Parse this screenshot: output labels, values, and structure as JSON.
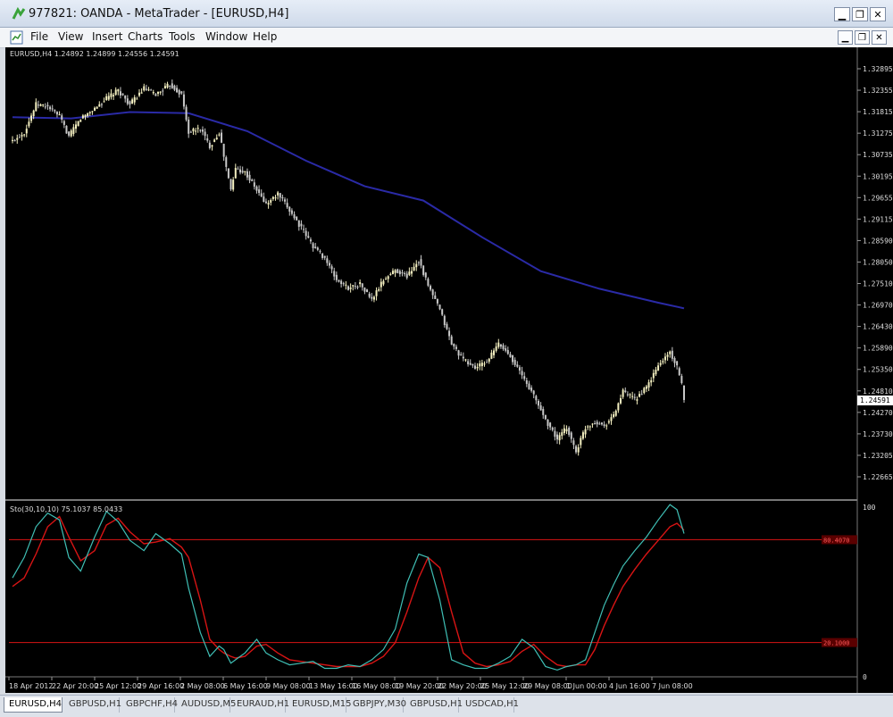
{
  "window": {
    "title": "977821: OANDA - MetaTrader - [EURUSD,H4]",
    "controls": [
      "minimize",
      "restore",
      "close"
    ]
  },
  "menu": {
    "items": [
      "File",
      "View",
      "Insert",
      "Charts",
      "Tools",
      "Window",
      "Help"
    ]
  },
  "chart": {
    "info_line": "EURUSD,H4  1.24892 1.24899 1.24556 1.24591",
    "current_price": "1.24591",
    "price_ticks": [
      "1.32895",
      "1.32355",
      "1.31815",
      "1.31275",
      "1.30735",
      "1.30195",
      "1.29655",
      "1.29115",
      "1.28590",
      "1.28050",
      "1.27510",
      "1.26970",
      "1.26430",
      "1.25890",
      "1.25350",
      "1.24810",
      "1.24270",
      "1.23730",
      "1.23205",
      "1.22665"
    ],
    "time_ticks": [
      "18 Apr 2012",
      "22 Apr 20:00",
      "25 Apr 12:00",
      "29 Apr 16:00",
      "2 May 08:00",
      "6 May 16:00",
      "9 May 08:00",
      "13 May 16:00",
      "16 May 08:00",
      "19 May 20:00",
      "22 May 20:00",
      "25 May 12:00",
      "29 May 08:00",
      "1 Jun 00:00",
      "4 Jun 16:00",
      "7 Jun 08:00"
    ],
    "indicator_info": "Sto(30,10,10) 75.1037 85.0433",
    "indicator_ticks": [
      "100",
      "0"
    ],
    "level_high": "80.4070",
    "level_low": "20.1000",
    "colors": {
      "background": "#000000",
      "candle_up": "#f3efc0",
      "candle_down": "#c8c8c8",
      "ma": "#2a2aa6",
      "stoch_main": "#3fbfb5",
      "stoch_signal": "#d81414",
      "levels": "#d81414"
    }
  },
  "chart_data": {
    "type": "candlestick",
    "symbol": "EURUSD",
    "timeframe": "H4",
    "x_start": "18 Apr 2012",
    "x_end": "7 Jun 08:00",
    "ylim": [
      1.22665,
      1.32895
    ],
    "price_path": [
      [
        0,
        1.3108
      ],
      [
        5,
        1.313
      ],
      [
        10,
        1.32
      ],
      [
        15,
        1.3195
      ],
      [
        20,
        1.317
      ],
      [
        24,
        1.312
      ],
      [
        29,
        1.3165
      ],
      [
        35,
        1.319
      ],
      [
        40,
        1.3215
      ],
      [
        45,
        1.3235
      ],
      [
        50,
        1.32
      ],
      [
        56,
        1.324
      ],
      [
        61,
        1.3225
      ],
      [
        67,
        1.325
      ],
      [
        72,
        1.3225
      ],
      [
        75,
        1.313
      ],
      [
        80,
        1.314
      ],
      [
        84,
        1.3095
      ],
      [
        88,
        1.313
      ],
      [
        90,
        1.307
      ],
      [
        93,
        1.2985
      ],
      [
        95,
        1.304
      ],
      [
        99,
        1.303
      ],
      [
        104,
        1.2985
      ],
      [
        108,
        1.295
      ],
      [
        113,
        1.2975
      ],
      [
        118,
        1.2935
      ],
      [
        123,
        1.289
      ],
      [
        128,
        1.2845
      ],
      [
        133,
        1.2815
      ],
      [
        138,
        1.276
      ],
      [
        143,
        1.274
      ],
      [
        148,
        1.275
      ],
      [
        153,
        1.271
      ],
      [
        158,
        1.276
      ],
      [
        163,
        1.2785
      ],
      [
        168,
        1.277
      ],
      [
        173,
        1.281
      ],
      [
        177,
        1.2745
      ],
      [
        182,
        1.2685
      ],
      [
        187,
        1.26
      ],
      [
        192,
        1.256
      ],
      [
        197,
        1.254
      ],
      [
        202,
        1.2555
      ],
      [
        207,
        1.26
      ],
      [
        212,
        1.257
      ],
      [
        217,
        1.252
      ],
      [
        222,
        1.247
      ],
      [
        227,
        1.241
      ],
      [
        232,
        1.236
      ],
      [
        236,
        1.239
      ],
      [
        240,
        1.233
      ],
      [
        244,
        1.239
      ],
      [
        248,
        1.2405
      ],
      [
        252,
        1.2395
      ],
      [
        256,
        1.242
      ],
      [
        260,
        1.248
      ],
      [
        265,
        1.246
      ],
      [
        270,
        1.249
      ],
      [
        275,
        1.2545
      ],
      [
        280,
        1.258
      ],
      [
        283,
        1.254
      ],
      [
        286,
        1.2475
      ]
    ],
    "ma_values": [
      [
        0,
        1.3168
      ],
      [
        25,
        1.3165
      ],
      [
        50,
        1.3181
      ],
      [
        75,
        1.3178
      ],
      [
        100,
        1.3133
      ],
      [
        125,
        1.3059
      ],
      [
        150,
        1.2995
      ],
      [
        175,
        1.2959
      ],
      [
        200,
        1.2867
      ],
      [
        225,
        1.2782
      ],
      [
        250,
        1.2738
      ],
      [
        275,
        1.2703
      ],
      [
        286,
        1.2689
      ]
    ],
    "stochastic": {
      "ylim": [
        0,
        100
      ],
      "levels": [
        80.407,
        20.1
      ],
      "main_value": 75.1037,
      "signal_value": 85.0433,
      "main": [
        [
          0,
          58
        ],
        [
          5,
          70
        ],
        [
          10,
          88
        ],
        [
          15,
          96
        ],
        [
          20,
          92
        ],
        [
          24,
          70
        ],
        [
          29,
          62
        ],
        [
          35,
          82
        ],
        [
          40,
          97
        ],
        [
          45,
          91
        ],
        [
          50,
          80
        ],
        [
          56,
          74
        ],
        [
          61,
          84
        ],
        [
          67,
          78
        ],
        [
          72,
          72
        ],
        [
          75,
          52
        ],
        [
          80,
          26
        ],
        [
          84,
          12
        ],
        [
          88,
          18
        ],
        [
          90,
          16
        ],
        [
          93,
          8
        ],
        [
          95,
          10
        ],
        [
          99,
          14
        ],
        [
          104,
          22
        ],
        [
          108,
          14
        ],
        [
          113,
          10
        ],
        [
          118,
          7
        ],
        [
          123,
          8
        ],
        [
          128,
          9
        ],
        [
          133,
          5
        ],
        [
          138,
          5
        ],
        [
          143,
          7
        ],
        [
          148,
          6
        ],
        [
          153,
          10
        ],
        [
          158,
          16
        ],
        [
          163,
          28
        ],
        [
          168,
          55
        ],
        [
          173,
          72
        ],
        [
          177,
          70
        ],
        [
          182,
          45
        ],
        [
          187,
          10
        ],
        [
          192,
          7
        ],
        [
          197,
          5
        ],
        [
          202,
          5
        ],
        [
          207,
          8
        ],
        [
          212,
          12
        ],
        [
          217,
          22
        ],
        [
          222,
          17
        ],
        [
          227,
          6
        ],
        [
          232,
          4
        ],
        [
          236,
          6
        ],
        [
          240,
          7
        ],
        [
          244,
          10
        ],
        [
          248,
          26
        ],
        [
          252,
          42
        ],
        [
          256,
          54
        ],
        [
          260,
          65
        ],
        [
          265,
          74
        ],
        [
          270,
          82
        ],
        [
          275,
          92
        ],
        [
          280,
          101
        ],
        [
          283,
          98
        ],
        [
          286,
          84
        ]
      ],
      "signal": [
        [
          0,
          53
        ],
        [
          5,
          58
        ],
        [
          10,
          72
        ],
        [
          15,
          88
        ],
        [
          20,
          94
        ],
        [
          24,
          82
        ],
        [
          29,
          68
        ],
        [
          35,
          74
        ],
        [
          40,
          89
        ],
        [
          45,
          93
        ],
        [
          50,
          85
        ],
        [
          56,
          78
        ],
        [
          61,
          79
        ],
        [
          67,
          81
        ],
        [
          72,
          76
        ],
        [
          75,
          70
        ],
        [
          80,
          45
        ],
        [
          84,
          22
        ],
        [
          88,
          16
        ],
        [
          90,
          14
        ],
        [
          93,
          12
        ],
        [
          95,
          11
        ],
        [
          99,
          12
        ],
        [
          104,
          18
        ],
        [
          108,
          19
        ],
        [
          113,
          14
        ],
        [
          118,
          10
        ],
        [
          123,
          9
        ],
        [
          128,
          8
        ],
        [
          133,
          7
        ],
        [
          138,
          6
        ],
        [
          143,
          6
        ],
        [
          148,
          6
        ],
        [
          153,
          8
        ],
        [
          158,
          12
        ],
        [
          163,
          20
        ],
        [
          168,
          38
        ],
        [
          173,
          58
        ],
        [
          177,
          70
        ],
        [
          182,
          64
        ],
        [
          187,
          38
        ],
        [
          192,
          14
        ],
        [
          197,
          8
        ],
        [
          202,
          6
        ],
        [
          207,
          7
        ],
        [
          212,
          9
        ],
        [
          217,
          15
        ],
        [
          222,
          19
        ],
        [
          227,
          12
        ],
        [
          232,
          7
        ],
        [
          236,
          6
        ],
        [
          240,
          7
        ],
        [
          244,
          7
        ],
        [
          248,
          16
        ],
        [
          252,
          30
        ],
        [
          256,
          42
        ],
        [
          260,
          53
        ],
        [
          265,
          63
        ],
        [
          270,
          72
        ],
        [
          275,
          80
        ],
        [
          280,
          88
        ],
        [
          283,
          90
        ],
        [
          286,
          86
        ]
      ]
    }
  },
  "tabs": {
    "items": [
      "EURUSD,H4",
      "GBPUSD,H1",
      "GBPCHF,H4",
      "AUDUSD,M5",
      "EURAUD,H1",
      "EURUSD,M15",
      "GBPJPY,M30",
      "GBPUSD,H1",
      "USDCAD,H1"
    ],
    "active": 0
  }
}
